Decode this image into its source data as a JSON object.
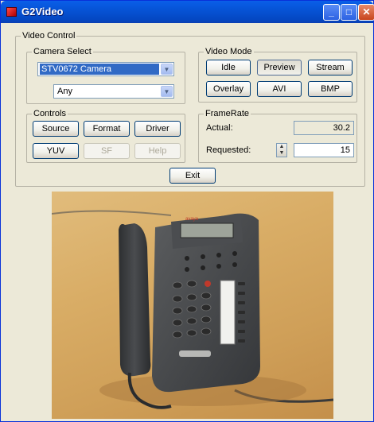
{
  "window": {
    "title": "G2Video"
  },
  "video_control": {
    "legend": "Video Control",
    "camera_select": {
      "legend": "Camera Select",
      "camera_value": "STV0672 Camera",
      "format_value": "Any"
    },
    "video_mode": {
      "legend": "Video Mode",
      "buttons": [
        "Idle",
        "Preview",
        "Stream",
        "Overlay",
        "AVI",
        "BMP"
      ]
    },
    "controls": {
      "legend": "Controls",
      "buttons": [
        "Source",
        "Format",
        "Driver",
        "YUV",
        "SF",
        "Help"
      ]
    },
    "frame_rate": {
      "legend": "FrameRate",
      "actual_label": "Actual:",
      "actual_value": "30.2",
      "requested_label": "Requested:",
      "requested_value": "15"
    },
    "exit_label": "Exit"
  },
  "icons": [
    "app-icon",
    "minimize-icon",
    "maximize-icon",
    "close-icon",
    "chevron-down-icon",
    "spin-arrows-icon"
  ],
  "colors": {
    "titlebar": "#0653d6",
    "selection": "#316ac5",
    "window_bg": "#ece9d8"
  }
}
